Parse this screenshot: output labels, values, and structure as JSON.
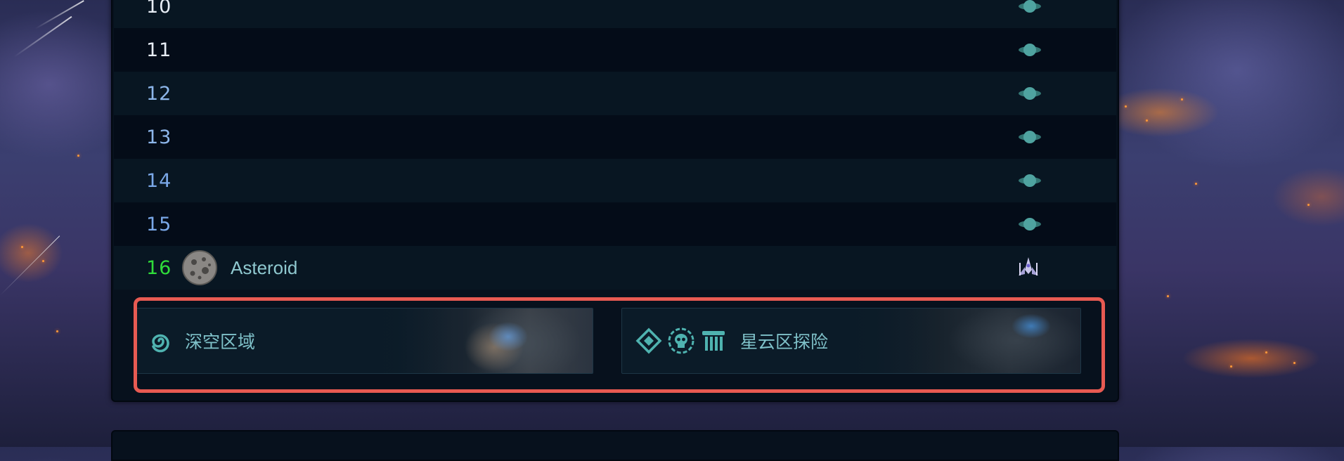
{
  "rows": [
    {
      "number": "10",
      "icon": "planet-icon"
    },
    {
      "number": "11",
      "icon": "planet-icon"
    },
    {
      "number": "12",
      "icon": "planet-icon"
    },
    {
      "number": "13",
      "icon": "planet-icon"
    },
    {
      "number": "14",
      "icon": "planet-icon"
    },
    {
      "number": "15",
      "icon": "planet-icon"
    },
    {
      "number": "16",
      "label": "Asteroid",
      "left_icon": "asteroid-icon",
      "icon": "spaceship-icon"
    }
  ],
  "actions": {
    "deep_space": {
      "label": "深空区域",
      "icon": "spiral-icon"
    },
    "nebula": {
      "label": "星云区探险",
      "icons": [
        "diamond-emblem-icon",
        "skull-icon",
        "pillar-icon"
      ]
    }
  },
  "colors": {
    "highlight": "#e85a52",
    "panel": "#07111d",
    "number_green": "#2fdc3a",
    "label_teal": "#8fc8cf"
  }
}
